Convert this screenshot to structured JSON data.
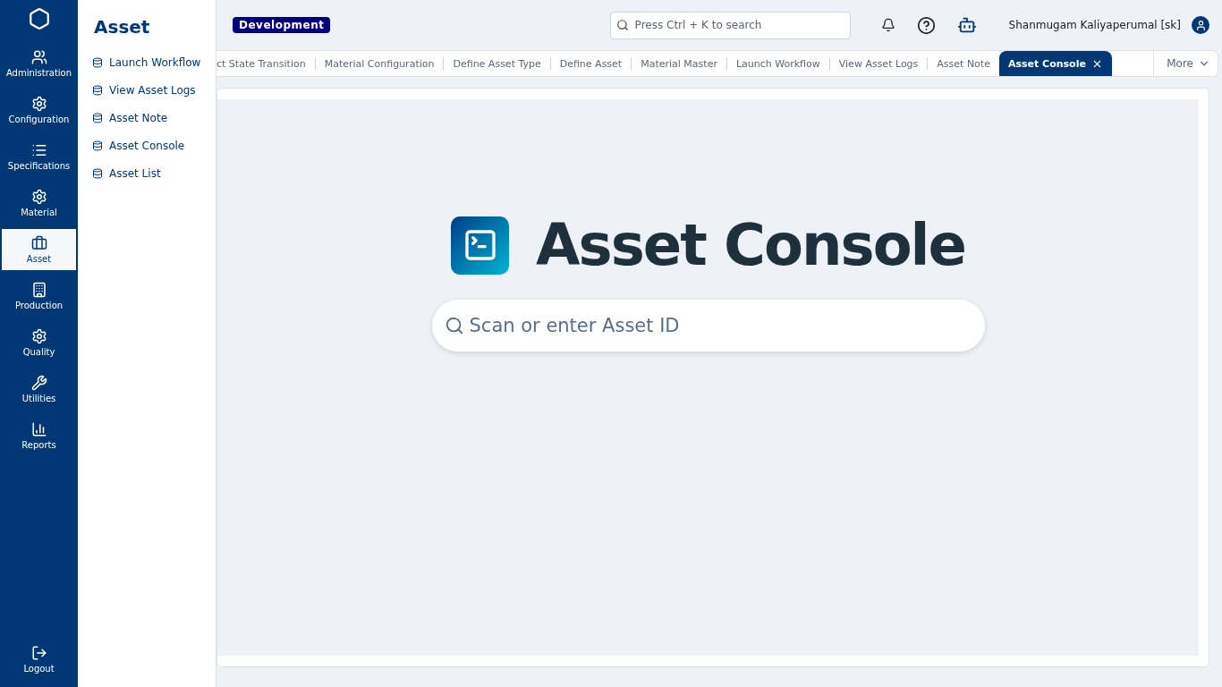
{
  "nav": [
    {
      "label": "Administration",
      "selected": false
    },
    {
      "label": "Configuration",
      "selected": false
    },
    {
      "label": "Specifications",
      "selected": false
    },
    {
      "label": "Material",
      "selected": false
    },
    {
      "label": "Asset",
      "selected": true
    },
    {
      "label": "Production",
      "selected": false
    },
    {
      "label": "Quality",
      "selected": false
    },
    {
      "label": "Utilities",
      "selected": false
    },
    {
      "label": "Reports",
      "selected": false
    }
  ],
  "logout": "Logout",
  "flyout": {
    "title": "Asset",
    "items": [
      "Launch Workflow",
      "View Asset Logs",
      "Asset Note",
      "Asset Console",
      "Asset List"
    ]
  },
  "environment": "Development",
  "search": {
    "placeholder": "Press Ctrl + K to search"
  },
  "user": "Shanmugam Kaliyaperumal [sk]",
  "tabs": [
    {
      "label": "ct State Transition",
      "selected": false
    },
    {
      "label": "Material Configuration",
      "selected": false
    },
    {
      "label": "Define Asset Type",
      "selected": false
    },
    {
      "label": "Define Asset",
      "selected": false
    },
    {
      "label": "Material Master",
      "selected": false
    },
    {
      "label": "Launch Workflow",
      "selected": false
    },
    {
      "label": "View Asset Logs",
      "selected": false
    },
    {
      "label": "Asset Note",
      "selected": false
    },
    {
      "label": "Asset Console",
      "selected": true
    }
  ],
  "more": "More",
  "console": {
    "title": "Asset Console",
    "placeholder": "Scan or enter Asset ID"
  }
}
